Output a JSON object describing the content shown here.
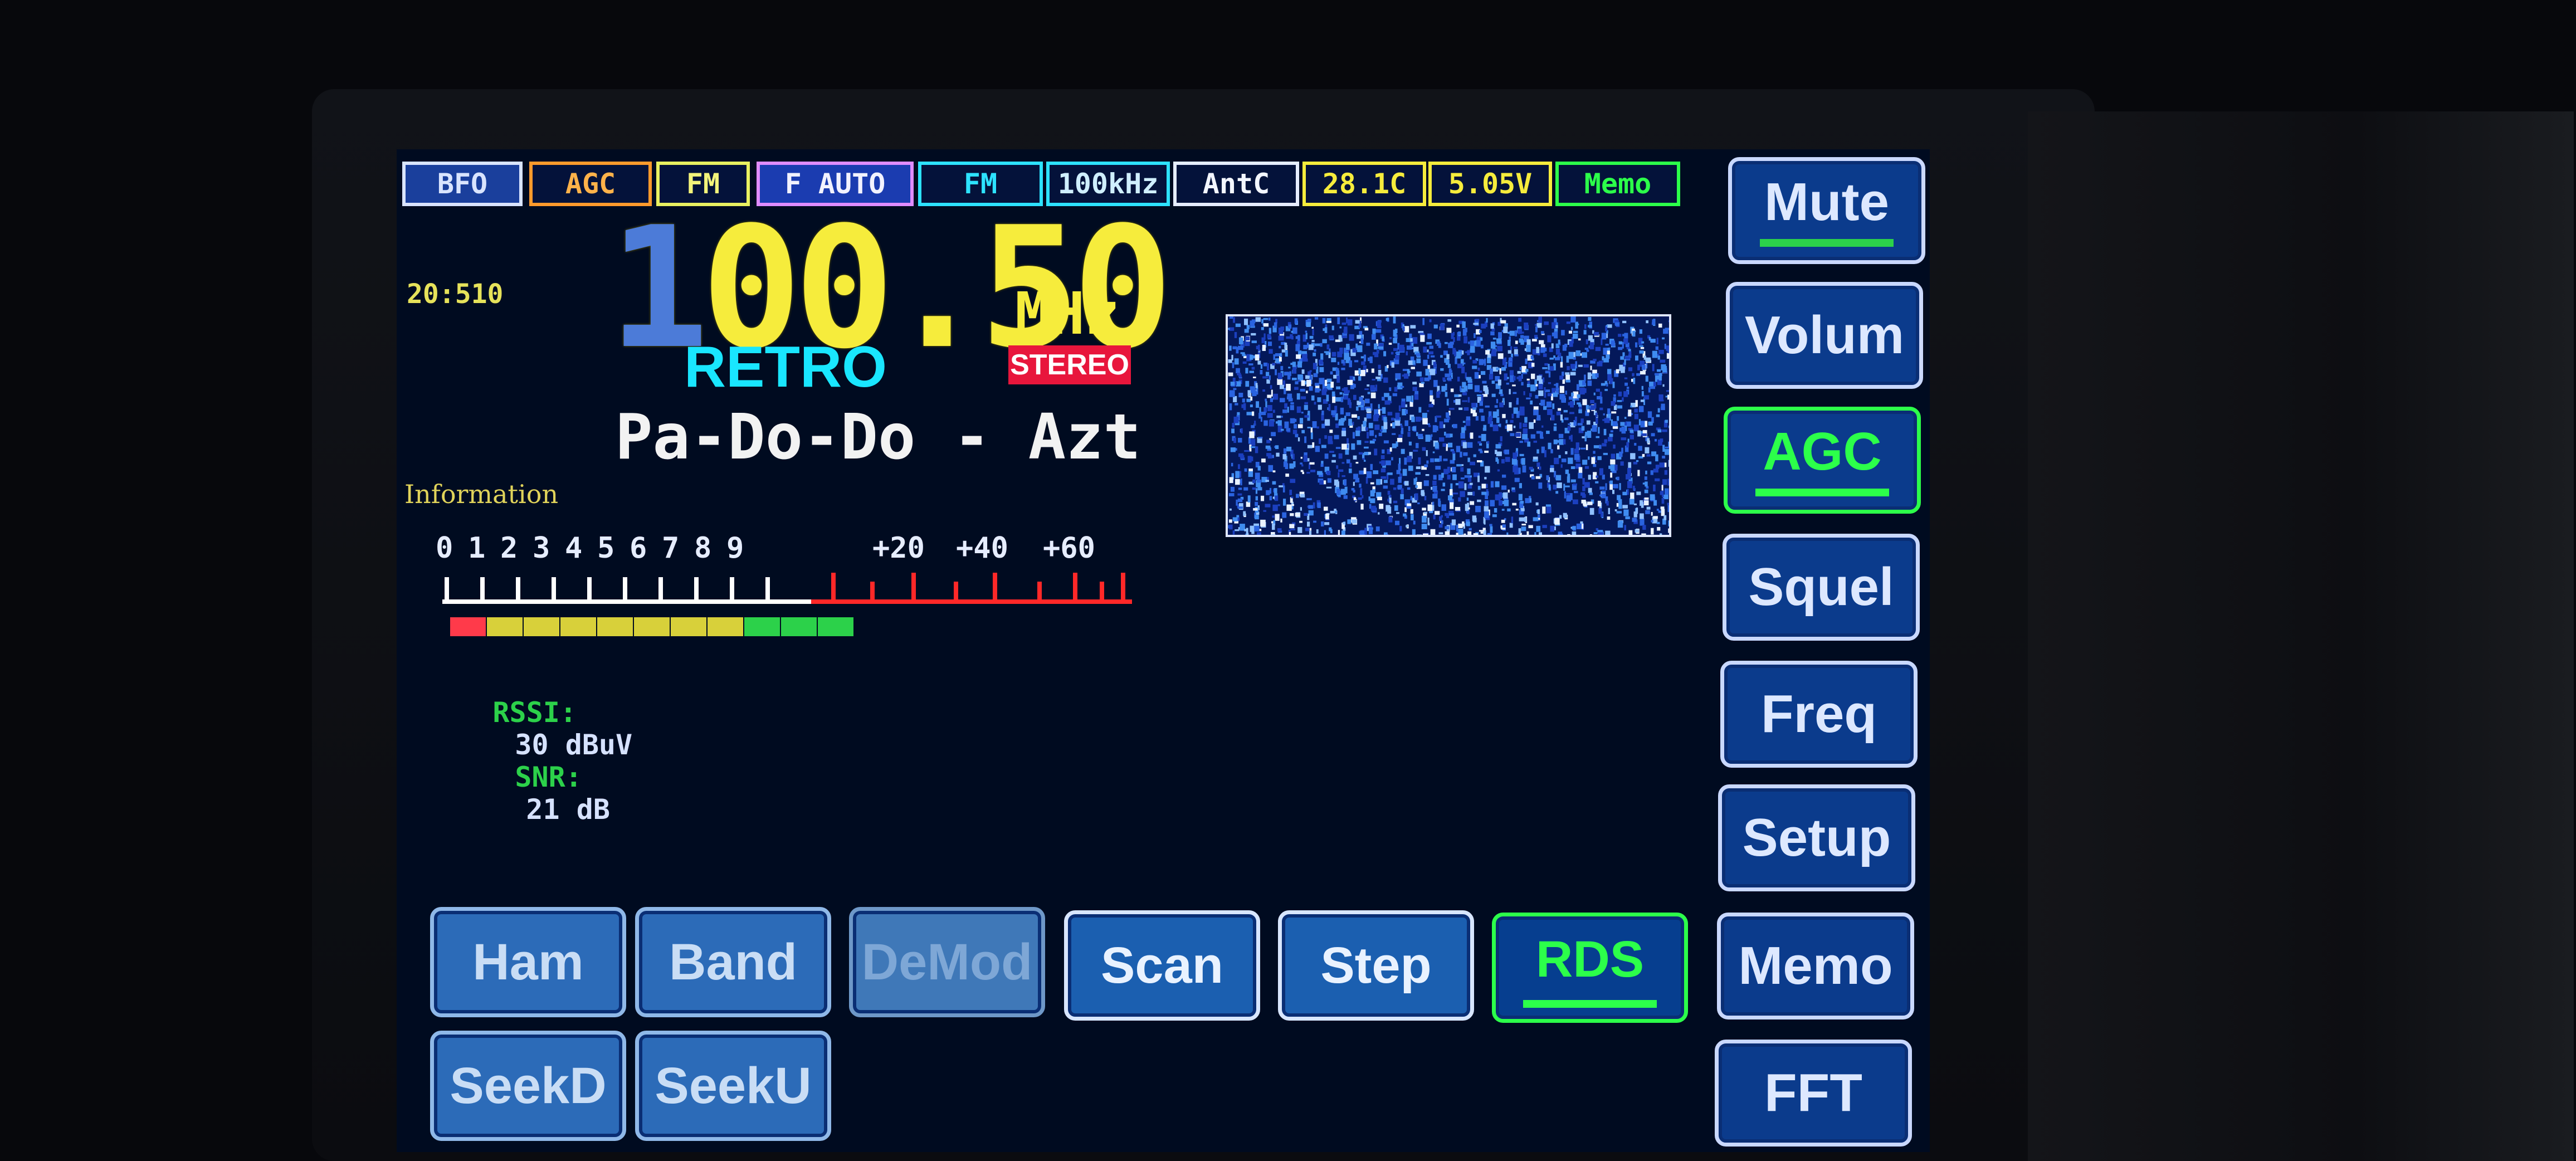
{
  "status_bar": {
    "bfo": "BFO",
    "agc": "AGC",
    "fm1": "FM",
    "f_auto": "F AUTO",
    "fm2": "FM",
    "step": "100kHz",
    "antenna": "AntC",
    "temperature": "28.1C",
    "voltage": "5.05V",
    "memo": "Memo"
  },
  "clock": "20:510",
  "frequency": {
    "dim_digit": "1",
    "value": "00.50",
    "unit": "MHz"
  },
  "station_name": "RETRO",
  "stereo_badge": "STEREO",
  "radiotext": "Pa-Do-Do - Azt",
  "info_label": "Information",
  "smeter": {
    "scale_labels": [
      "0",
      "1",
      "2",
      "3",
      "4",
      "5",
      "6",
      "7",
      "8",
      "9",
      "+20",
      "+40",
      "+60"
    ],
    "level_fraction": 0.6
  },
  "signal": {
    "rssi_label": "RSSI:",
    "rssi_value": "30 dBuV",
    "snr_label": "SNR:",
    "snr_value": "21 dB"
  },
  "side_buttons": [
    {
      "label": "Mute",
      "active": false,
      "underline": true
    },
    {
      "label": "Volum",
      "active": false,
      "underline": false
    },
    {
      "label": "AGC",
      "active": true,
      "underline": true
    },
    {
      "label": "Squel",
      "active": false,
      "underline": false
    },
    {
      "label": "Freq",
      "active": false,
      "underline": false
    },
    {
      "label": "Setup",
      "active": false,
      "underline": false
    },
    {
      "label": "Memo",
      "active": false,
      "underline": false
    },
    {
      "label": "FFT",
      "active": false,
      "underline": false
    }
  ],
  "bottom_buttons": [
    {
      "label": "Ham",
      "state": "normal"
    },
    {
      "label": "Band",
      "state": "normal"
    },
    {
      "label": "DeMod",
      "state": "disabled"
    },
    {
      "label": "Scan",
      "state": "hi"
    },
    {
      "label": "Step",
      "state": "hi"
    },
    {
      "label": "RDS",
      "state": "active"
    },
    {
      "label": "SeekD",
      "state": "normal"
    },
    {
      "label": "SeekU",
      "state": "normal"
    }
  ],
  "colors": {
    "frequency": "#f6ec3c",
    "station": "#19e6ff",
    "active": "#2cff4a",
    "stereo_bg": "#e8163c"
  }
}
